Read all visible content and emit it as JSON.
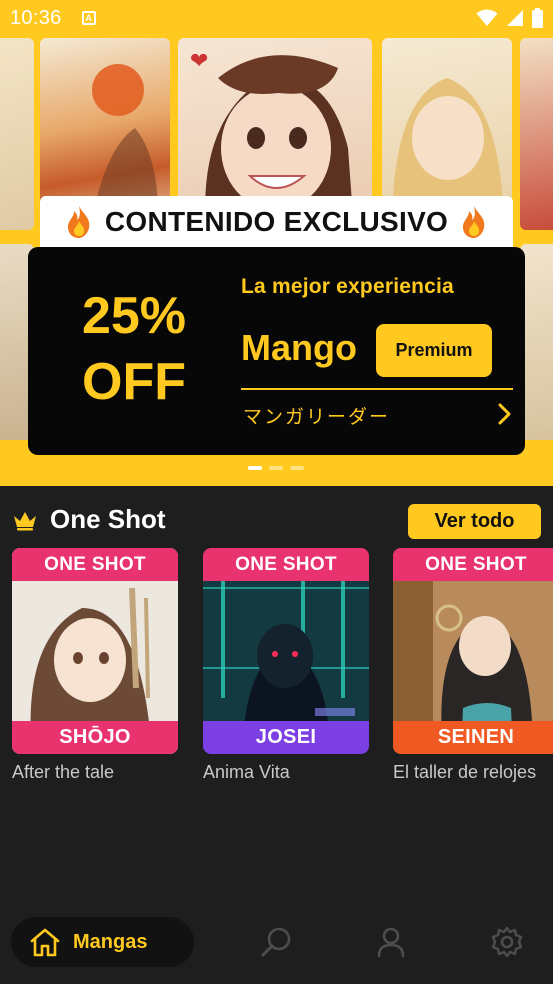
{
  "status_bar": {
    "time": "10:36",
    "notification_glyph": "A",
    "icons": [
      "wifi-icon",
      "signal-icon",
      "battery-icon"
    ]
  },
  "hero": {
    "exclusive_label": "CONTENIDO EXCLUSIVO",
    "promo": {
      "discount_percent": "25%",
      "discount_off": "OFF",
      "tagline": "La mejor experiencia",
      "brand": "Mango",
      "premium_label": "Premium",
      "subtitle": "マンガリーダー"
    },
    "carousel": {
      "pages": 3,
      "active_index": 0
    }
  },
  "section": {
    "icon": "crown-icon",
    "title": "One Shot",
    "see_all_label": "Ver todo",
    "cards": [
      {
        "badge": "ONE SHOT",
        "genre": "SHŌJO",
        "title": "After the tale",
        "badge_color": "#e8336f",
        "genre_color": "#e8336f"
      },
      {
        "badge": "ONE SHOT",
        "genre": "JOSEI",
        "title": "Anima Vita",
        "badge_color": "#e8336f",
        "genre_color": "#7b3fe4"
      },
      {
        "badge": "ONE SHOT",
        "genre": "SEINEN",
        "title": "El taller de relojes",
        "badge_color": "#e8336f",
        "genre_color": "#f05a22"
      }
    ]
  },
  "bottom_nav": {
    "items": [
      {
        "label": "Mangas",
        "icon": "home-icon",
        "active": true
      },
      {
        "label": "",
        "icon": "search-icon",
        "active": false
      },
      {
        "label": "",
        "icon": "profile-icon",
        "active": false
      },
      {
        "label": "",
        "icon": "settings-icon",
        "active": false
      }
    ]
  },
  "colors": {
    "accent": "#ffc91f",
    "panel": "#1e1e1e",
    "promo_bg": "#070707"
  }
}
